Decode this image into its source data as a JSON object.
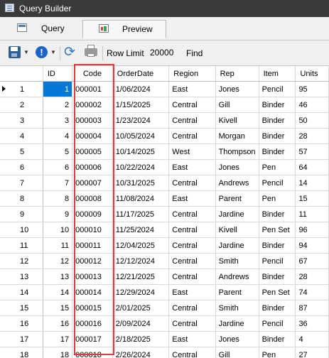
{
  "window": {
    "title": "Query Builder"
  },
  "tabs": [
    {
      "label": "Query",
      "icon": "query-icon"
    },
    {
      "label": "Preview",
      "icon": "chart-icon"
    }
  ],
  "toolbar": {
    "row_limit_label": "Row Limit",
    "row_limit_value": "20000",
    "find_label": "Find",
    "find_value": ""
  },
  "grid": {
    "columns": [
      "",
      "ID",
      "Code",
      "OrderDate",
      "Region",
      "Rep",
      "Item",
      "Units"
    ],
    "selected_cell": {
      "row": 0,
      "column": "ID"
    },
    "highlighted_column": "Code",
    "highlight_color": "#e03a3a",
    "selection_color": "#0078d7",
    "rows": [
      [
        "1",
        "1",
        "000001",
        "1/06/2024",
        "East",
        "Jones",
        "Pencil",
        "95"
      ],
      [
        "2",
        "2",
        "000002",
        "1/15/2025",
        "Central",
        "Gill",
        "Binder",
        "46"
      ],
      [
        "3",
        "3",
        "000003",
        "1/23/2024",
        "Central",
        "Kivell",
        "Binder",
        "50"
      ],
      [
        "4",
        "4",
        "000004",
        "10/05/2024",
        "Central",
        "Morgan",
        "Binder",
        "28"
      ],
      [
        "5",
        "5",
        "000005",
        "10/14/2025",
        "West",
        "Thompson",
        "Binder",
        "57"
      ],
      [
        "6",
        "6",
        "000006",
        "10/22/2024",
        "East",
        "Jones",
        "Pen",
        "64"
      ],
      [
        "7",
        "7",
        "000007",
        "10/31/2025",
        "Central",
        "Andrews",
        "Pencil",
        "14"
      ],
      [
        "8",
        "8",
        "000008",
        "11/08/2024",
        "East",
        "Parent",
        "Pen",
        "15"
      ],
      [
        "9",
        "9",
        "000009",
        "11/17/2025",
        "Central",
        "Jardine",
        "Binder",
        "11"
      ],
      [
        "10",
        "10",
        "000010",
        "11/25/2024",
        "Central",
        "Kivell",
        "Pen Set",
        "96"
      ],
      [
        "11",
        "11",
        "000011",
        "12/04/2025",
        "Central",
        "Jardine",
        "Binder",
        "94"
      ],
      [
        "12",
        "12",
        "000012",
        "12/12/2024",
        "Central",
        "Smith",
        "Pencil",
        "67"
      ],
      [
        "13",
        "13",
        "000013",
        "12/21/2025",
        "Central",
        "Andrews",
        "Binder",
        "28"
      ],
      [
        "14",
        "14",
        "000014",
        "12/29/2024",
        "East",
        "Parent",
        "Pen Set",
        "74"
      ],
      [
        "15",
        "15",
        "000015",
        "2/01/2025",
        "Central",
        "Smith",
        "Binder",
        "87"
      ],
      [
        "16",
        "16",
        "000016",
        "2/09/2024",
        "Central",
        "Jardine",
        "Pencil",
        "36"
      ],
      [
        "17",
        "17",
        "000017",
        "2/18/2025",
        "East",
        "Jones",
        "Binder",
        "4"
      ],
      [
        "18",
        "18",
        "000018",
        "2/26/2024",
        "Central",
        "Gill",
        "Pen",
        "27"
      ]
    ]
  }
}
